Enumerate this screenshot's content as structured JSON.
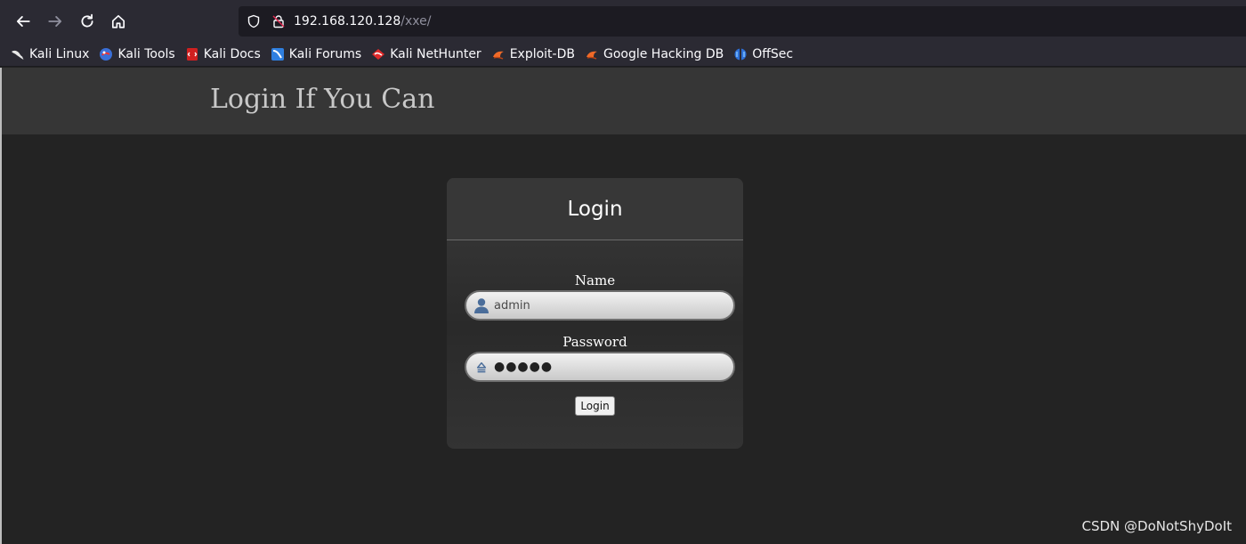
{
  "browser": {
    "url_host": "192.168.120.128",
    "url_path": "/xxe/"
  },
  "bookmarks": [
    {
      "label": "Kali Linux",
      "icon": "kali-dragon-icon"
    },
    {
      "label": "Kali Tools",
      "icon": "kali-tools-icon"
    },
    {
      "label": "Kali Docs",
      "icon": "kali-docs-icon"
    },
    {
      "label": "Kali Forums",
      "icon": "kali-forums-icon"
    },
    {
      "label": "Kali NetHunter",
      "icon": "nethunter-icon"
    },
    {
      "label": "Exploit-DB",
      "icon": "exploit-db-icon"
    },
    {
      "label": "Google Hacking DB",
      "icon": "ghdb-icon"
    },
    {
      "label": "OffSec",
      "icon": "offsec-icon"
    }
  ],
  "page": {
    "site_title": "Login If You Can",
    "login": {
      "heading": "Login",
      "name_label": "Name",
      "name_value": "admin",
      "password_label": "Password",
      "password_value": "●●●●●",
      "button_label": "Login"
    }
  },
  "watermark": "CSDN @DoNotShyDoIt"
}
